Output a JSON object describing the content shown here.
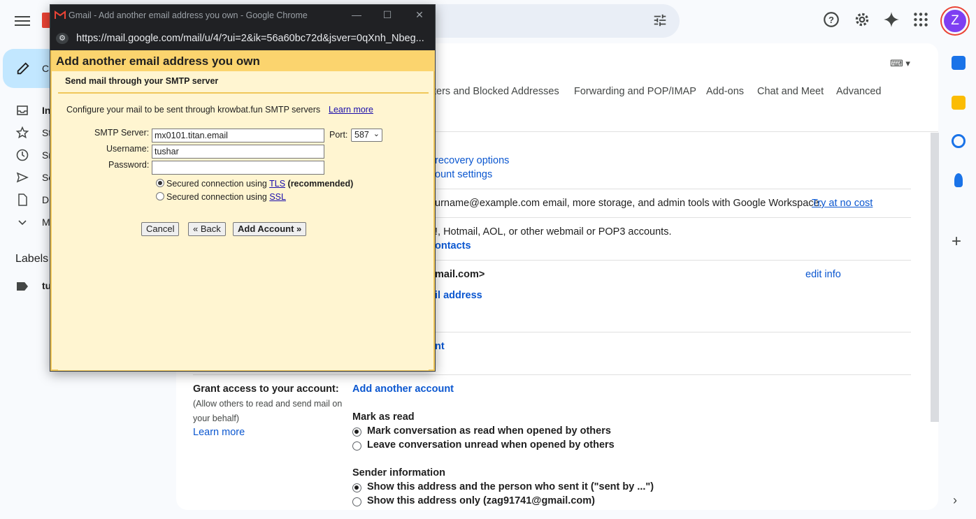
{
  "gmail": {
    "compose_label": "C",
    "nav": [
      "In",
      "St",
      "Sn",
      "Se",
      "Dr",
      "M"
    ],
    "labels_heading": "Labels",
    "label_item": "tu",
    "tabs": [
      "ters and Blocked Addresses",
      "Forwarding and POP/IMAP",
      "Add-ons",
      "Chat and Meet",
      "Advanced"
    ],
    "rows": {
      "recovery": "recovery options",
      "account_settings": "ount settings",
      "workspace_text": "urname@example.com email, more storage, and admin tools with Google Workspace.",
      "workspace_link": "Try at no cost",
      "import_text": "!, Hotmail, AOL, or other webmail or POP3 accounts.",
      "contacts": "ontacts",
      "send_as": "mail.com>",
      "edit_info": "edit info",
      "add_email": "il address",
      "nt": "nt",
      "grant_label": "Grant access to your account:",
      "grant_sub1": "(Allow others to read and send mail on",
      "grant_sub2": "your behalf)",
      "learn_more": "Learn more",
      "add_another_account": "Add another account",
      "mark_as_read": "Mark as read",
      "mark_read_opt": "Mark conversation as read when opened by others",
      "leave_unread_opt": "Leave conversation unread when opened by others",
      "sender_info": "Sender information",
      "sender_opt1": "Show this address and the person who sent it (\"sent by ...\")",
      "sender_opt2": "Show this address only (zag91741@gmail.com)"
    },
    "avatar_letter": "Z"
  },
  "popup": {
    "window_title": "Gmail - Add another email address you own - Google Chrome",
    "url": "https://mail.google.com/mail/u/4/?ui=2&ik=56a60bc72d&jsver=0qXnh_Nbeg...",
    "heading": "Add another email address you own",
    "subheading": "Send mail through your SMTP server",
    "configure_text": "Configure your mail to be sent through krowbat.fun SMTP servers",
    "learn_more": "Learn more",
    "smtp_label": "SMTP Server:",
    "smtp_value": "mx0101.titan.email",
    "port_label": "Port:",
    "port_value": "587",
    "username_label": "Username:",
    "username_value": "tushar",
    "password_label": "Password:",
    "password_value": "",
    "tls_text": "Secured connection using",
    "tls_link": "TLS",
    "tls_recommended": "(recommended)",
    "ssl_text": "Secured connection using",
    "ssl_link": "SSL",
    "cancel": "Cancel",
    "back": "« Back",
    "add_account": "Add Account »"
  }
}
